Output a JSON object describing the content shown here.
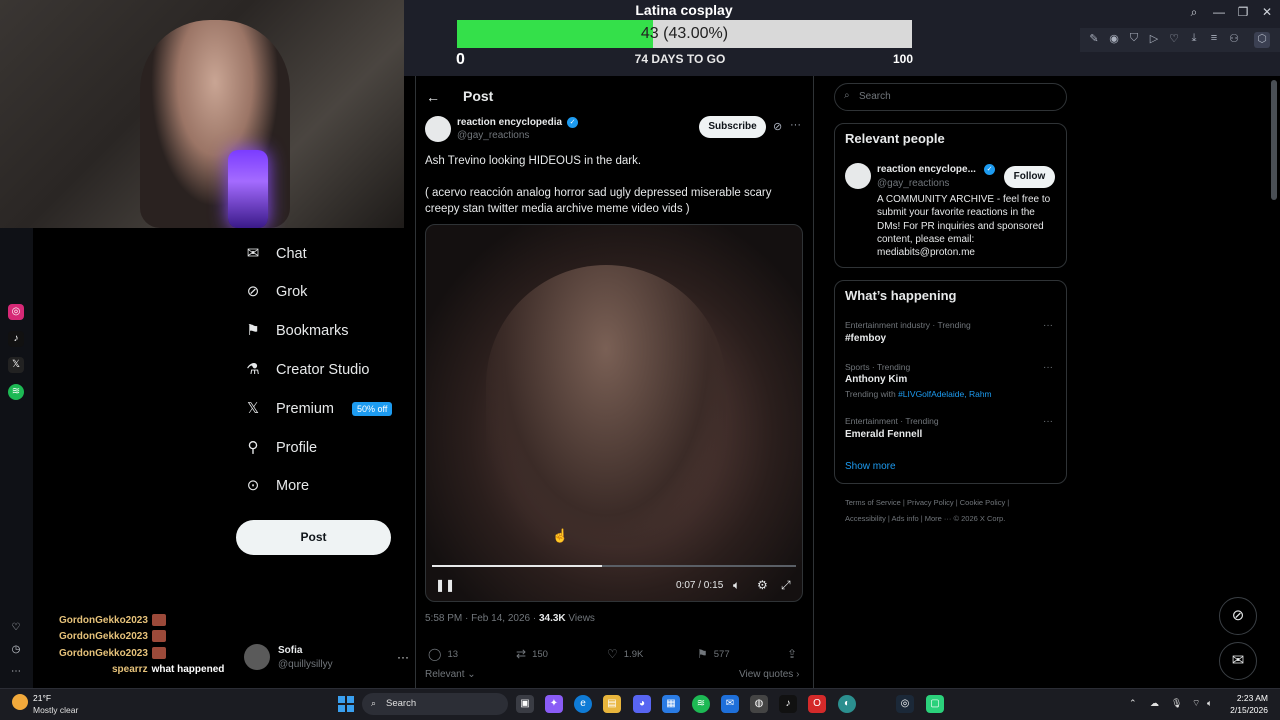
{
  "goal": {
    "title": "Latina cosplay",
    "label": "43 (43.00%)",
    "progress_fraction": 0.43,
    "min": "0",
    "days_to_go": "74 DAYS TO GO",
    "max": "100"
  },
  "window_controls": {
    "search": "⌕",
    "minimize": "—",
    "restore": "❐",
    "close": "✕"
  },
  "left_rail": [
    {
      "icon": "instagram-icon",
      "color": "#d62976"
    },
    {
      "icon": "tiktok-icon",
      "color": "#111111"
    },
    {
      "icon": "x-icon",
      "color": "#222222"
    },
    {
      "icon": "spotify-icon",
      "color": "#1db954"
    }
  ],
  "nav": {
    "chat": "Chat",
    "grok": "Grok",
    "bookmarks": "Bookmarks",
    "creator_studio": "Creator Studio",
    "premium": "Premium",
    "premium_badge": "50% off",
    "profile": "Profile",
    "more": "More",
    "post_button": "Post"
  },
  "account": {
    "name": "Sofia",
    "handle": "@quillysillyy",
    "menu": "···"
  },
  "chat": [
    {
      "user": "GordonGekko2023",
      "text": ""
    },
    {
      "user": "GordonGekko2023",
      "text": ""
    },
    {
      "user": "GordonGekko2023",
      "text": ""
    },
    {
      "user": "spearrz",
      "text": "what happened"
    }
  ],
  "post": {
    "header": "Post",
    "author_name": "reaction encyclopedia",
    "author_handle": "@gay_reactions",
    "subscribe": "Subscribe",
    "text": "Ash Trevino looking HIDEOUS in the dark.",
    "tags": "( acervo reacción analog horror sad ugly depressed miserable scary creepy stan twitter media archive meme video vids )",
    "video_time": "0:07 / 0:15",
    "video_progress_fraction": 0.4667,
    "timestamp": "5:58 PM · Feb 14, 2026 · ",
    "views_count": "34.3K",
    "views_label": " Views",
    "replies": "13",
    "reposts": "150",
    "likes": "1.9K",
    "bookmarks": "577",
    "relevant": "Relevant",
    "view_quotes": "View quotes"
  },
  "right": {
    "search_placeholder": "Search",
    "people_title": "Relevant people",
    "person_name": "reaction encyclope...",
    "person_handle": "@gay_reactions",
    "follow": "Follow",
    "person_bio": "A COMMUNITY ARCHIVE - feel free to submit your favorite reactions in the DMs! For PR inquiries and sponsored content, please email: mediabits@proton.me",
    "happening_title": "What’s happening",
    "trends": [
      {
        "category": "Entertainment industry · Trending",
        "name": "#femboy"
      },
      {
        "category": "Sports · Trending",
        "name": "Anthony Kim"
      },
      {
        "category": "Entertainment · Trending",
        "name": "Emerald Fennell"
      }
    ],
    "trending_with_prefix": "Trending with ",
    "trending_with_links": "#LIVGolfAdelaide, Rahm",
    "show_more": "Show more",
    "footer_1": "Terms of Service  |  Privacy Policy  |  Cookie Policy  |",
    "footer_2": "Accessibility  |  Ads info  |  More ···   © 2026 X Corp."
  },
  "taskbar": {
    "temp": "21°F",
    "weather": "Mostly clear",
    "search": "Search",
    "time": "2:23 AM",
    "date": "2/15/2026"
  },
  "colors": {
    "accent": "#1d9bf0",
    "goal_fill": "#34e04a",
    "background": "#000000"
  }
}
